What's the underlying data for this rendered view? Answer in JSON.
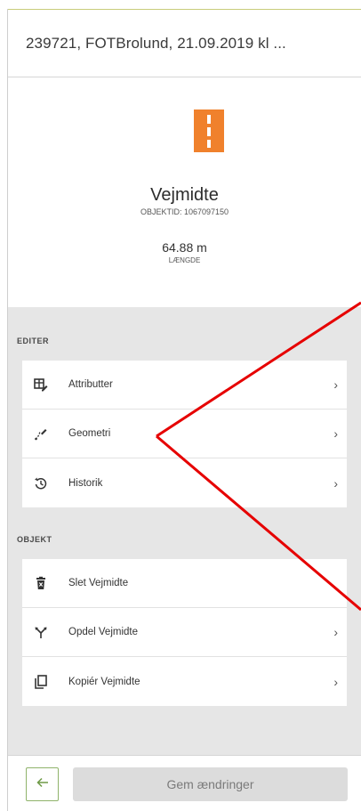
{
  "header": {
    "title": "239721, FOTBrolund, 21.09.2019 kl ..."
  },
  "object": {
    "name": "Vejmidte",
    "id_label": "OBJEKTID: 1067097150",
    "length_value": "64.88 m",
    "length_label": "LÆNGDE",
    "icon": "road-icon",
    "icon_color": "#f0812c"
  },
  "sections": {
    "edit": {
      "title": "EDITER",
      "items": [
        {
          "label": "Attributter",
          "icon": "table-edit-icon",
          "chevron": "›"
        },
        {
          "label": "Geometri",
          "icon": "geometry-pen-icon",
          "chevron": "›"
        },
        {
          "label": "Historik",
          "icon": "history-icon",
          "chevron": "›"
        }
      ]
    },
    "object": {
      "title": "OBJEKT",
      "items": [
        {
          "label": "Slet Vejmidte",
          "icon": "trash-icon",
          "chevron": ""
        },
        {
          "label": "Opdel Vejmidte",
          "icon": "split-icon",
          "chevron": "›"
        },
        {
          "label": "Kopiér Vejmidte",
          "icon": "copy-icon",
          "chevron": "›"
        }
      ]
    }
  },
  "footer": {
    "back_icon": "arrow-left-icon",
    "save_label": "Gem ændringer"
  },
  "annotation_color": "#e60000"
}
